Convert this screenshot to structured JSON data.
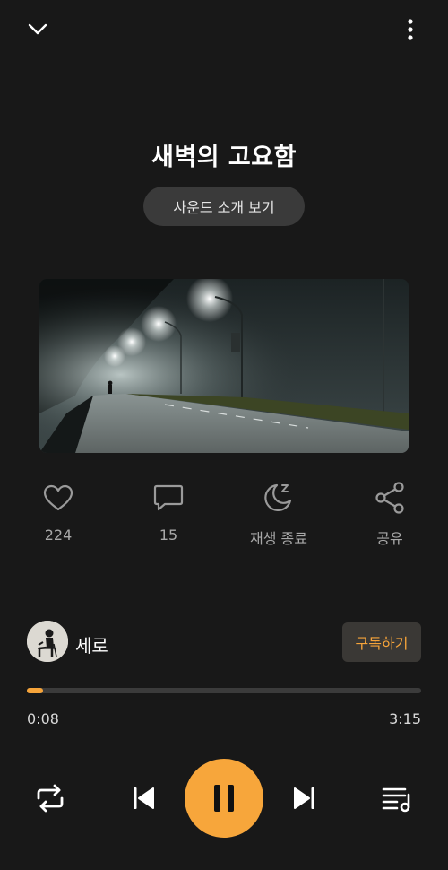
{
  "header": {
    "collapse_icon": "chevron-down-icon",
    "more_icon": "more-vertical-icon"
  },
  "track": {
    "title": "새벽의 고요함",
    "intro_button": "사운드 소개 보기"
  },
  "actions": [
    {
      "icon": "heart-icon",
      "label": "224"
    },
    {
      "icon": "comment-icon",
      "label": "15"
    },
    {
      "icon": "sleep-timer-icon",
      "label": "재생 종료"
    },
    {
      "icon": "share-icon",
      "label": "공유"
    }
  ],
  "creator": {
    "name": "세로",
    "subscribe_label": "구독하기"
  },
  "progress": {
    "current": "0:08",
    "total": "3:15",
    "fraction": 0.041
  },
  "controls": {
    "repeat_icon": "repeat-icon",
    "previous_icon": "skip-previous-icon",
    "play_state_icon": "pause-icon",
    "next_icon": "skip-next-icon",
    "playlist_icon": "playlist-icon"
  },
  "colors": {
    "background": "#181818",
    "accent": "#f6a43a"
  }
}
